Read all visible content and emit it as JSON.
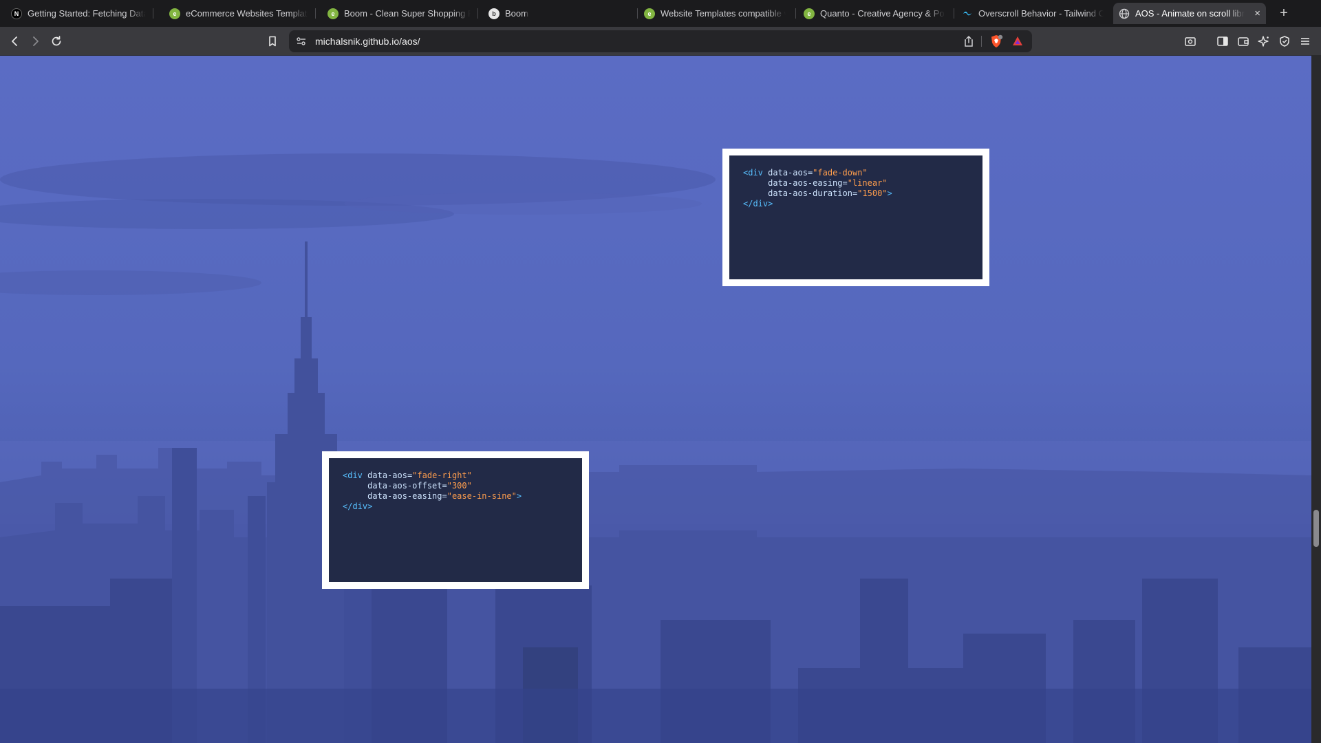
{
  "tabs": [
    {
      "title": "Getting Started: Fetching Data |",
      "icon": "nextjs-icon"
    },
    {
      "title": "eCommerce Websites Templates",
      "icon": "envato-icon"
    },
    {
      "title": "Boom - Clean Super Shopping P",
      "icon": "envato-icon"
    },
    {
      "title": "Boom",
      "icon": "boom-icon"
    },
    {
      "title": "Website Templates compatible v",
      "icon": "envato-icon"
    },
    {
      "title": "Quanto - Creative Agency & Por",
      "icon": "envato-icon"
    },
    {
      "title": "Overscroll Behavior - Tailwind C",
      "icon": "tailwind-icon"
    },
    {
      "title": "AOS - Animate on scroll libr",
      "icon": "globe-icon",
      "close": "×"
    }
  ],
  "new_tab": "+",
  "toolbar": {
    "url": "michalsnik.github.io/aos/"
  },
  "code_blocks": [
    {
      "open": "<div",
      "attr1": "data-aos=",
      "val1": "\"fade-down\"",
      "attr2": "data-aos-easing=",
      "val2": "\"linear\"",
      "attr3": "data-aos-duration=",
      "val3": "\"1500\"",
      "end": ">",
      "close": "</div>"
    },
    {
      "open": "<div",
      "attr1": "data-aos=",
      "val1": "\"fade-right\"",
      "attr2": "data-aos-offset=",
      "val2": "\"300\"",
      "attr3": "data-aos-easing=",
      "val3": "\"ease-in-sine\"",
      "end": ">",
      "close": "</div>"
    }
  ],
  "colors": {
    "page_tint": "#5a6bc3",
    "code_bg": "#222a47",
    "code_tag": "#58c0ff",
    "code_value": "#ff9e4d"
  }
}
